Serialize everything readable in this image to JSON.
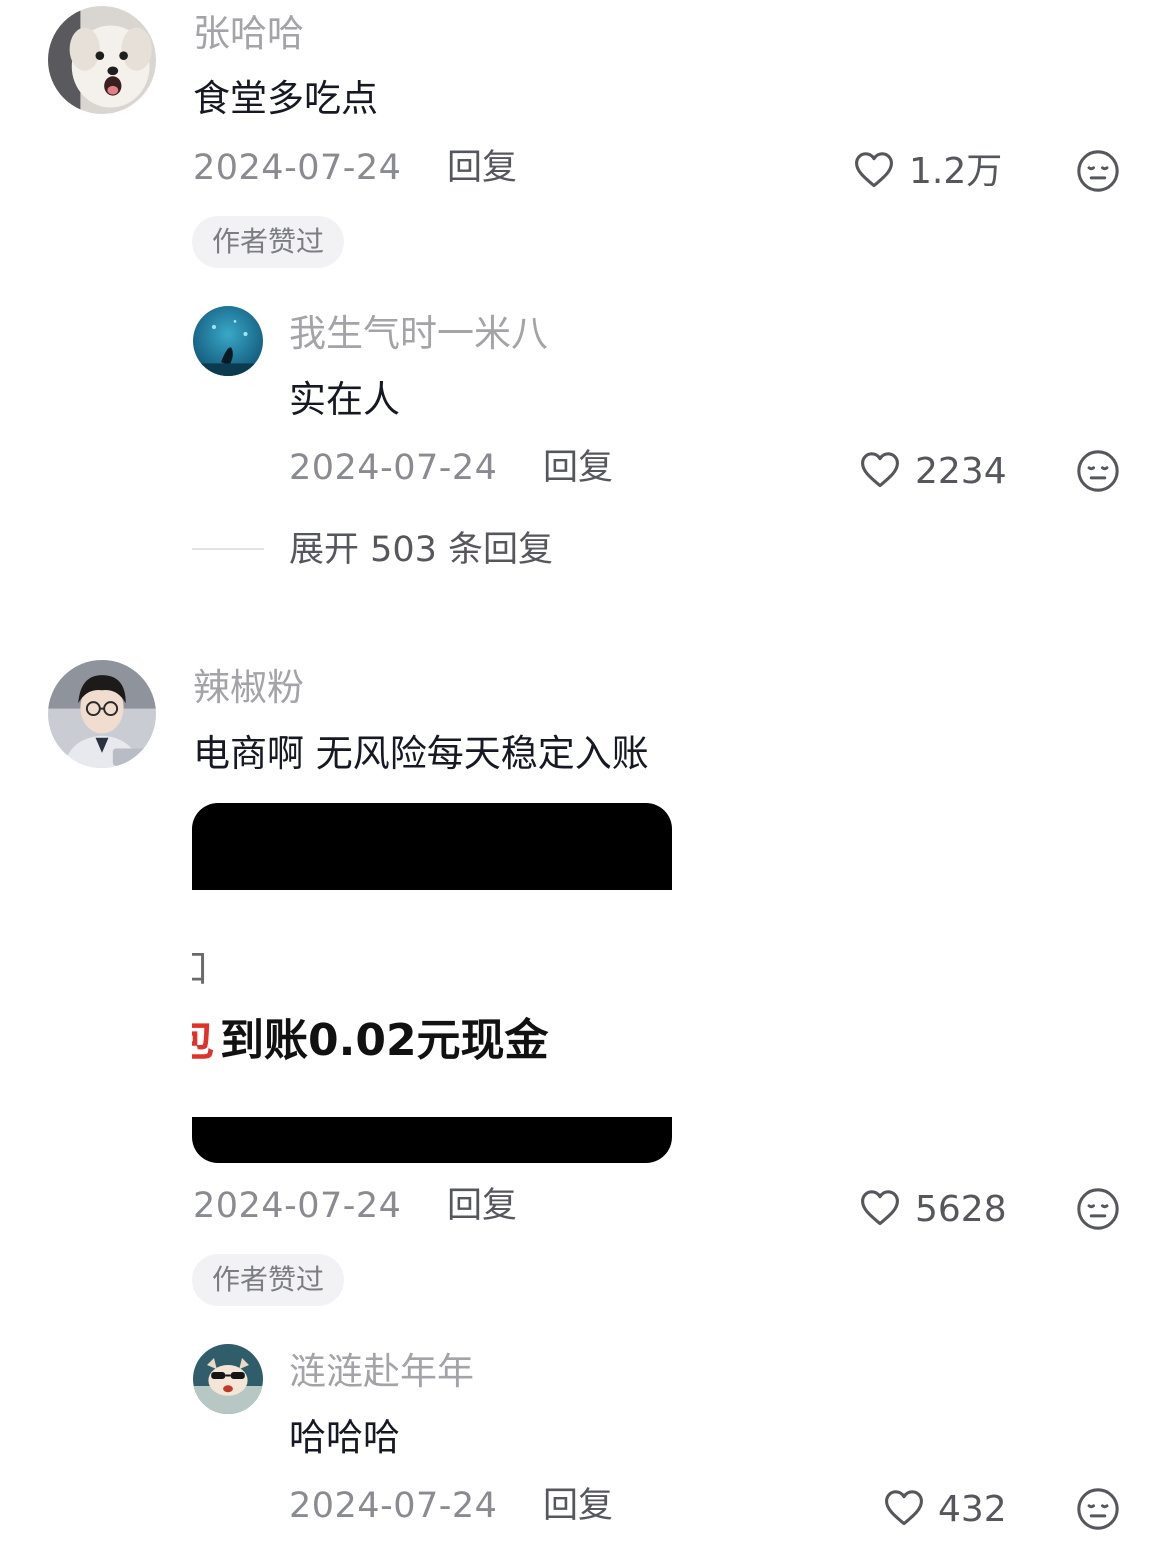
{
  "accent_colors": {
    "text": "#161823",
    "name": "#a3a3a8",
    "secondary": "#8a8b91",
    "badge_bg": "#f2f2f4"
  },
  "comments": [
    {
      "username": "张哈哈",
      "text": "食堂多吃点",
      "date": "2024-07-24",
      "reply_label": "回复",
      "likes": "1.2万",
      "badge": "作者赞过",
      "avatar_icon": "white-puppy-avatar",
      "replies": [
        {
          "username": "我生气时一米八",
          "text": "实在人",
          "date": "2024-07-24",
          "reply_label": "回复",
          "likes": "2234",
          "avatar_icon": "underwater-avatar"
        }
      ],
      "expand_label": "展开 503 条回复"
    },
    {
      "username": "辣椒粉",
      "text": "电商啊 无风险每天稳定入账",
      "image": {
        "partial_char": "扣",
        "highlight_char": "包",
        "main_text": "到账0.02元现金"
      },
      "date": "2024-07-24",
      "reply_label": "回复",
      "likes": "5628",
      "badge": "作者赞过",
      "avatar_icon": "young-man-glasses-avatar",
      "replies": [
        {
          "username": "涟涟赴年年",
          "text": "哈哈哈",
          "date": "2024-07-24",
          "reply_label": "回复",
          "likes": "432",
          "avatar_icon": "sunglasses-dog-avatar"
        }
      ]
    }
  ],
  "icons": {
    "like": "heart-outline-icon",
    "dislike": "neutral-face-icon"
  }
}
